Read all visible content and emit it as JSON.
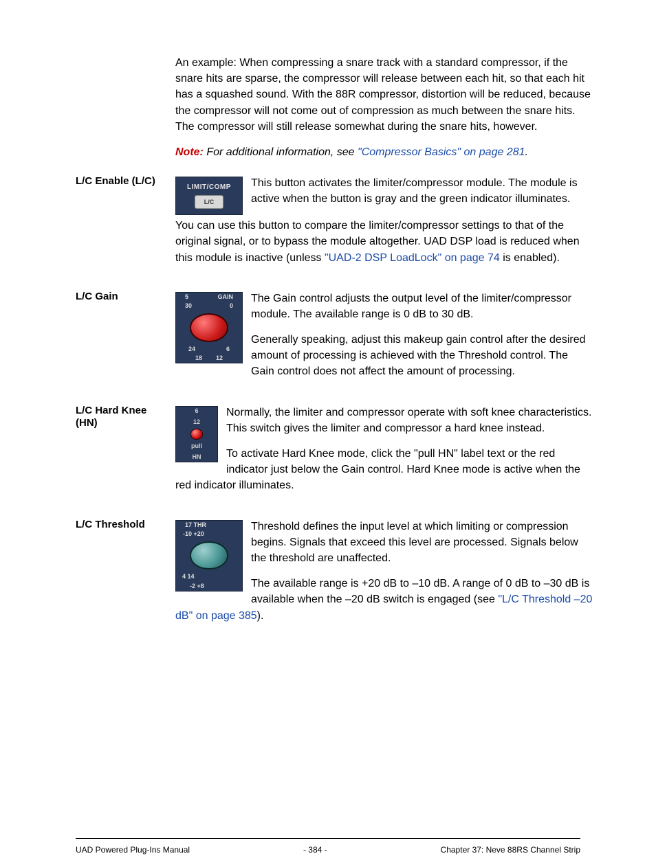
{
  "intro_para": "An example: When compressing a snare track with a standard compressor, if the snare hits are sparse, the compressor will release between each hit, so that each hit has a squashed sound. With the 88R compressor, distortion will be reduced, because the compressor will not come out of compression as much between the snare hits. The compressor will still release somewhat during the snare hits, however.",
  "note": {
    "label": "Note:",
    "text": "For additional information, see ",
    "link": "\"Compressor Basics\" on page 281",
    "tail": "."
  },
  "lc_enable": {
    "heading": "L/C Enable (L/C)",
    "icon_top": "LIMIT/COMP",
    "icon_btn": "L/C",
    "p1": "This button activates the limiter/compressor module. The module is active when the button is gray and the green indicator illuminates.",
    "p2a": "You can use this button to compare the limiter/compressor settings to that of the original signal, or to bypass the module altogether. UAD DSP load is reduced when this module is inactive (unless ",
    "p2_link": "\"UAD-2 DSP LoadLock\" on page 74",
    "p2b": " is enabled)."
  },
  "lc_gain": {
    "heading": "L/C Gain",
    "icon_label": "GAIN",
    "tick_5": "5",
    "tick_30": "30",
    "tick_0": "0",
    "tick_24": "24",
    "tick_6": "6",
    "tick_18": "18",
    "tick_12": "12",
    "p1": "The Gain control adjusts the output level of the limiter/compressor module. The available range is 0 dB to 30 dB.",
    "p2": "Generally speaking, adjust this makeup gain control after the desired amount of processing is achieved with the Threshold control. The Gain control does not affect the amount of processing."
  },
  "lc_hn": {
    "heading": "L/C Hard Knee (HN)",
    "tick_6": "6",
    "tick_12": "12",
    "pull_label": "pull",
    "hn_label": "HN",
    "p1": "Normally, the limiter and compressor operate with soft knee characteristics. This switch gives the limiter and compressor a hard knee instead.",
    "p2": "To activate Hard Knee mode, click the \"pull HN\" label text or the red indicator just below the Gain control. Hard Knee mode is active when the red indicator illuminates."
  },
  "lc_thr": {
    "heading": "L/C Threshold",
    "icon_label": "THR",
    "tick_17": "17",
    "tick_n10": "-10",
    "tick_p20": "+20",
    "tick_4": "4",
    "tick_14": "14",
    "tick_n2": "-2",
    "tick_p8": "+8",
    "p1": "Threshold defines the input level at which limiting or compression begins. Signals that exceed this level are processed. Signals below the threshold are unaffected.",
    "p2a": "The available range is +20 dB to –10 dB. A range of 0 dB to –30 dB is available when the –20 dB switch is engaged (see ",
    "p2_link": "\"L/C Threshold –20 dB\" on page 385",
    "p2b": ")."
  },
  "footer": {
    "left": "UAD Powered Plug-Ins Manual",
    "center": "- 384 -",
    "right": "Chapter 37: Neve 88RS Channel Strip"
  }
}
